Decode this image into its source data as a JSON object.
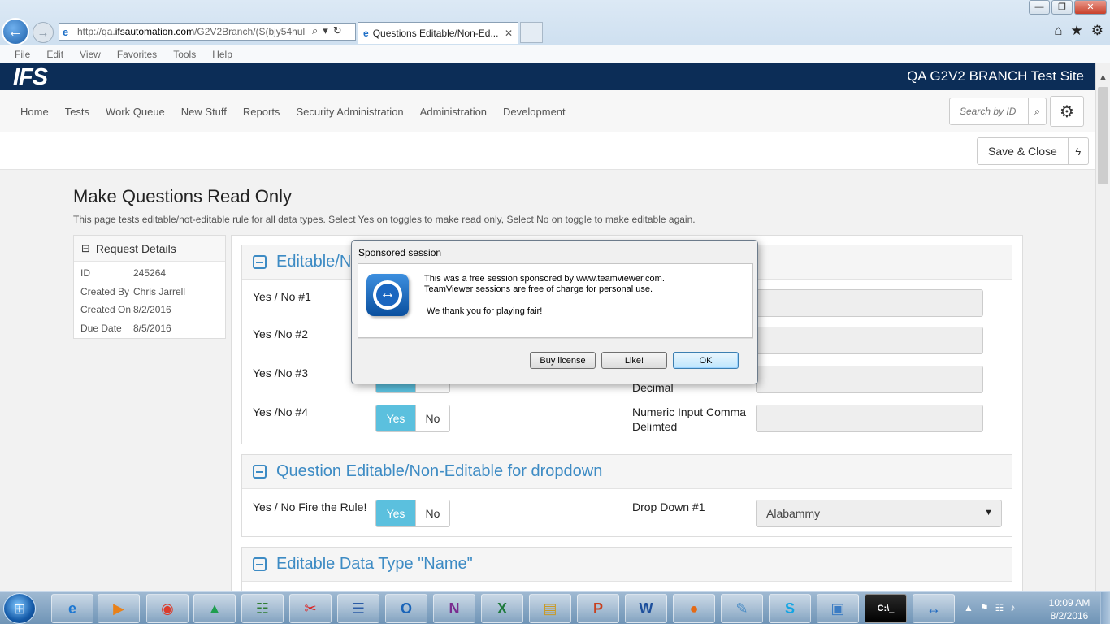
{
  "browser": {
    "url_prefix": "http://qa.",
    "url_domain": "ifsautomation.com",
    "url_rest": "/G2V2Branch/(S(bjy54hul",
    "tab_title": "Questions Editable/Non-Ed...",
    "menu": [
      "File",
      "Edit",
      "View",
      "Favorites",
      "Tools",
      "Help"
    ],
    "window_controls": {
      "minimize": "—",
      "restore": "❐",
      "close": "✕"
    }
  },
  "site": {
    "logo_text": "IFS",
    "title": "QA G2V2 BRANCH Test Site",
    "nav": [
      "Home",
      "Tests",
      "Work Queue",
      "New Stuff",
      "Reports",
      "Security Administration",
      "Administration",
      "Development"
    ],
    "search_placeholder": "Search by ID",
    "save_close_label": "Save & Close"
  },
  "page": {
    "title": "Make Questions Read Only",
    "description": "This page tests editable/not-editable rule for all data types. Select Yes on toggles to make read only, Select No on toggle to make editable again."
  },
  "request_details": {
    "header": "Request Details",
    "rows": [
      {
        "label": "ID",
        "value": "245264"
      },
      {
        "label": "Created By",
        "value": "Chris Jarrell"
      },
      {
        "label": "Created On",
        "value": "8/2/2016"
      },
      {
        "label": "Due Date",
        "value": "8/5/2016"
      }
    ]
  },
  "sections": {
    "s1": {
      "header": "Editable/No",
      "rows": [
        {
          "label": "Yes / No #1"
        },
        {
          "label": "Yes /No #2"
        },
        {
          "label": "Yes /No #3",
          "right_label": "Decimal"
        },
        {
          "label": "Yes /No #4",
          "right_label_1": "Numeric Input Comma",
          "right_label_2": "Delimted"
        }
      ]
    },
    "s2": {
      "header": "Question Editable/Non-Editable for dropdown",
      "left_label": "Yes / No Fire the Rule!",
      "right_label": "Drop Down #1",
      "dropdown_value": "Alabammy"
    },
    "s3": {
      "header": "Editable Data Type \"Name\""
    },
    "toggle": {
      "yes": "Yes",
      "no": "No"
    }
  },
  "dialog": {
    "title": "Sponsored session",
    "line1": "This was a free session sponsored by www.teamviewer.com.",
    "line2": "TeamViewer sessions are free of charge for personal use.",
    "line3": "We thank you for playing fair!",
    "buttons": {
      "buy": "Buy license",
      "like": "Like!",
      "ok": "OK"
    }
  },
  "taskbar": {
    "apps": [
      "ie-icon",
      "media-icon",
      "chrome-icon",
      "drive-icon",
      "project-icon",
      "snipping-icon",
      "network-icon",
      "outlook-icon",
      "onenote-icon",
      "excel-icon",
      "explorer-icon",
      "powerpoint-icon",
      "word-icon",
      "firefox-icon",
      "notepad-icon",
      "skype-icon",
      "photos-icon",
      "cmd-icon",
      "teamviewer-icon"
    ],
    "labels": {
      "outlook": "O",
      "onenote": "N",
      "excel": "X",
      "powerpoint": "P",
      "word": "W",
      "skype": "S",
      "cmd": "C:\\_"
    },
    "time": "10:09 AM",
    "date": "8/2/2016"
  }
}
